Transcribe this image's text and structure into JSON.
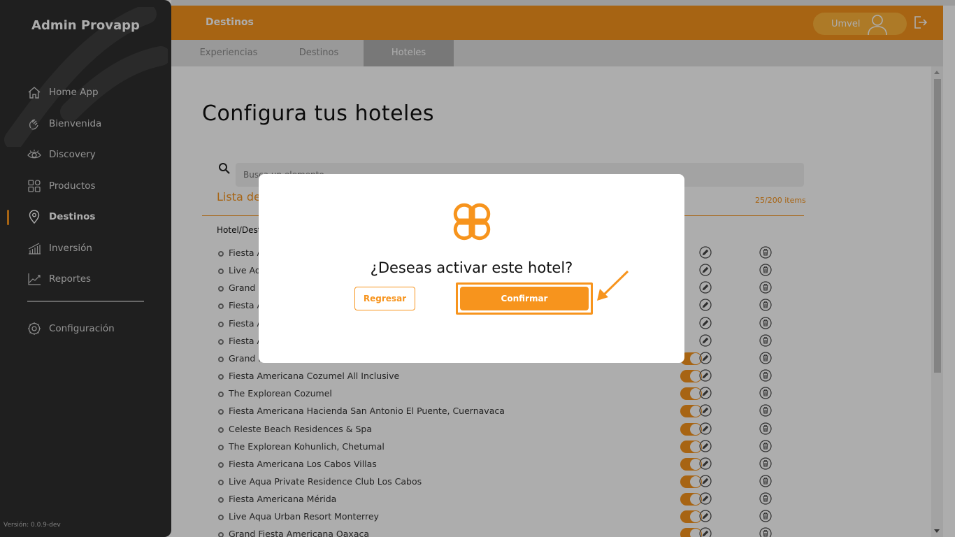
{
  "app": {
    "title": "Admin Provapp",
    "version": "Versión: 0.0.9-dev"
  },
  "sidebar": {
    "items": [
      {
        "label": "Home App",
        "icon": "home-icon"
      },
      {
        "label": "Bienvenida",
        "icon": "wave-hand-icon"
      },
      {
        "label": "Discovery",
        "icon": "eye-icon"
      },
      {
        "label": "Productos",
        "icon": "grid-icon"
      },
      {
        "label": "Destinos",
        "icon": "location-pin-icon",
        "active": true
      },
      {
        "label": "Inversión",
        "icon": "bar-chart-icon"
      },
      {
        "label": "Reportes",
        "icon": "line-chart-icon"
      }
    ],
    "config": {
      "label": "Configuración",
      "icon": "gear-icon"
    }
  },
  "header": {
    "title": "Destinos",
    "user": "Umvel"
  },
  "tabs": [
    {
      "label": "Experiencias"
    },
    {
      "label": "Destinos"
    },
    {
      "label": "Hoteles",
      "active": true
    }
  ],
  "content": {
    "title": "Configura tus hoteles",
    "search_placeholder": "Busca un elemento",
    "list_title": "Lista de",
    "items_count": "25/200 items",
    "column_header": "Hotel/Dest",
    "rows": [
      {
        "name": "Fiesta A"
      },
      {
        "name": "Live Aqu"
      },
      {
        "name": "Grand F"
      },
      {
        "name": "Fiesta A"
      },
      {
        "name": "Fiesta A"
      },
      {
        "name": "Fiesta A"
      },
      {
        "name": "Grand F"
      },
      {
        "name": "Fiesta Americana Cozumel All Inclusive"
      },
      {
        "name": "The Explorean Cozumel"
      },
      {
        "name": "Fiesta Americana Hacienda San Antonio El Puente, Cuernavaca"
      },
      {
        "name": "Celeste Beach Residences & Spa"
      },
      {
        "name": "The Explorean Kohunlich, Chetumal"
      },
      {
        "name": "Fiesta Americana Los Cabos Villas"
      },
      {
        "name": "Live Aqua Private Residence Club Los Cabos"
      },
      {
        "name": "Fiesta Americana Mérida"
      },
      {
        "name": "Live Aqua Urban Resort Monterrey"
      },
      {
        "name": "Grand Fiesta Americana Oaxaca"
      }
    ]
  },
  "modal": {
    "question": "¿Deseas activar este hotel?",
    "back_label": "Regresar",
    "confirm_label": "Confirmar"
  },
  "colors": {
    "accent": "#f7941d",
    "sidebar": "#2e2e2e"
  }
}
